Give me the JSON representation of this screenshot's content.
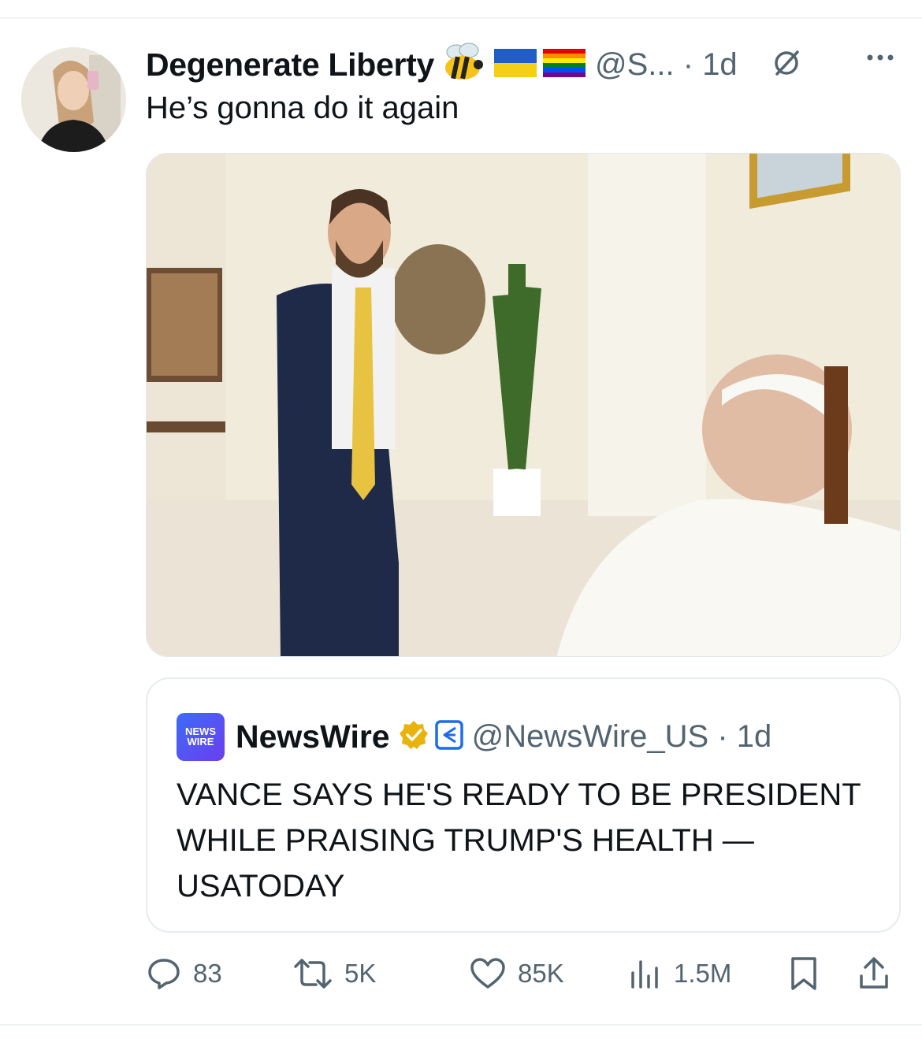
{
  "tweet": {
    "display_name": "Degenerate Liberty",
    "handle_time": "@S... · 1d",
    "text": "He’s gonna do it again"
  },
  "quote": {
    "logo_line1": "NEWS",
    "logo_line2": "WIRE",
    "name": "NewsWire",
    "handle_time": "@NewsWire_US · 1d",
    "text": "VANCE SAYS HE'S READY TO BE PRESIDENT WHILE PRAISING TRUMP'S HEALTH — USATODAY"
  },
  "actions": {
    "replies": "83",
    "reposts": "5K",
    "likes": "85K",
    "views": "1.5M"
  },
  "icons": [
    "bee-emoji-icon",
    "ukraine-flag-icon",
    "rainbow-flag-icon",
    "grok-icon",
    "more-icon",
    "verified-badge-icon",
    "affiliate-badge-icon",
    "reply-icon",
    "repost-icon",
    "like-icon",
    "views-icon",
    "bookmark-icon",
    "share-icon"
  ],
  "colors": {
    "text": "#0f1419",
    "muted": "#536471",
    "verified": "#e8b40b",
    "affiliate": "#1d6cf0"
  }
}
